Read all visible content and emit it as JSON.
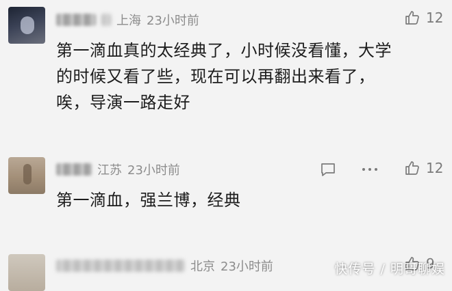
{
  "comments": [
    {
      "location": "上海",
      "time": "23小时前",
      "lines": [
        "第一滴血真的太经典了，小时候没看懂，大学",
        "的时候又看了些，现在可以再翻出来看了，",
        "唉，导演一路走好"
      ],
      "likes": "12",
      "icons": [
        "like-icon"
      ]
    },
    {
      "location": "江苏",
      "time": "23小时前",
      "lines": [
        "第一滴血，强兰博，经典"
      ],
      "likes": "12",
      "icons": [
        "reply-icon",
        "more-icon",
        "like-icon"
      ]
    },
    {
      "location": "北京",
      "time": "23小时前",
      "likes": "9",
      "icons": [
        "like-icon"
      ]
    }
  ],
  "watermark": "快传号 / 明哥聊娱",
  "colors": {
    "background": "#f3f3f3",
    "meta_text": "#8c8c8c",
    "body_text": "#1c1c1c",
    "icon": "#7a7a7a"
  }
}
